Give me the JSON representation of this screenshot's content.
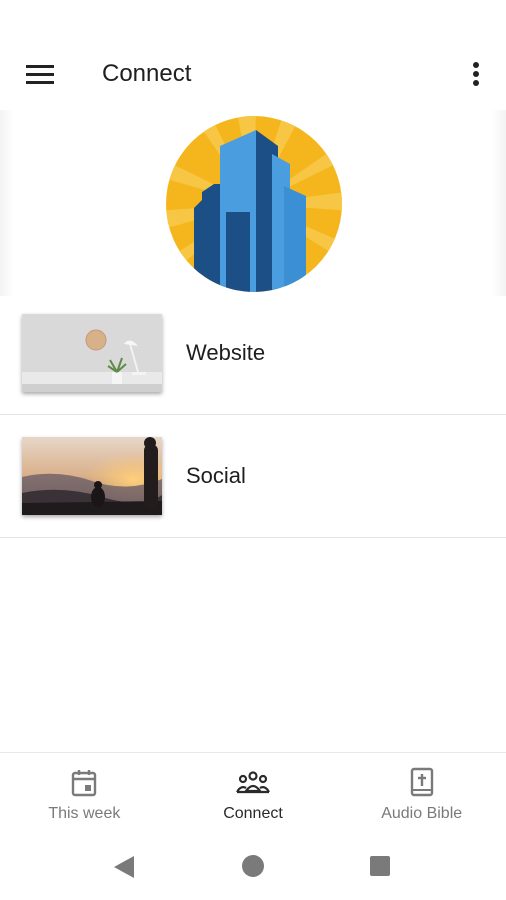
{
  "app_bar": {
    "title": "Connect",
    "menu_icon": "hamburger-menu-icon",
    "more_icon": "more-vert-icon"
  },
  "header": {
    "logo_icon": "building-sunburst-logo",
    "colors": {
      "sun": "#f4b61c",
      "building_dark": "#1b4f86",
      "building_light": "#4a9ee0"
    }
  },
  "list": {
    "items": [
      {
        "label": "Website",
        "thumbnail": "desk-plant-lamp-photo"
      },
      {
        "label": "Social",
        "thumbnail": "people-sunset-hills-photo"
      }
    ]
  },
  "bottom_nav": {
    "items": [
      {
        "label": "This week",
        "icon": "calendar-icon",
        "active": false
      },
      {
        "label": "Connect",
        "icon": "people-group-icon",
        "active": true
      },
      {
        "label": "Audio Bible",
        "icon": "bible-icon",
        "active": false
      }
    ]
  },
  "system_nav": {
    "back_icon": "triangle-back-icon",
    "home_icon": "circle-home-icon",
    "recents_icon": "square-recents-icon"
  }
}
